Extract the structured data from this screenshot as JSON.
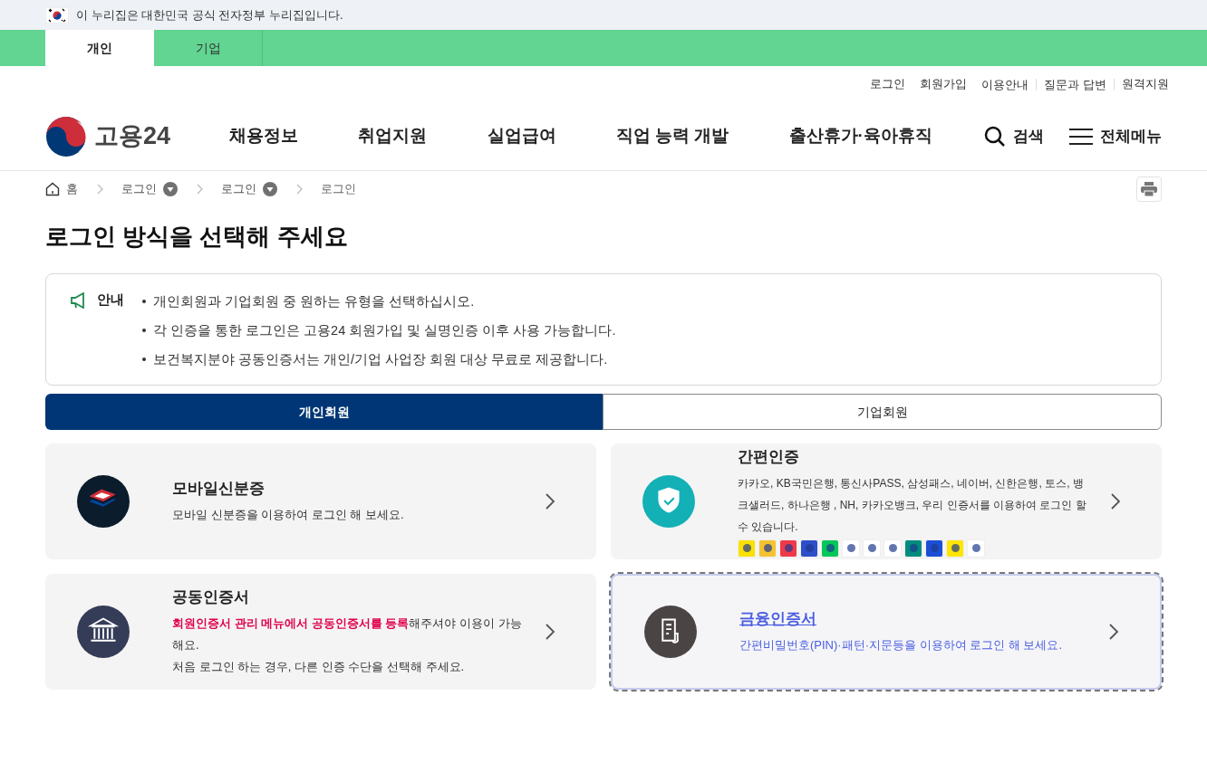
{
  "gov_banner": {
    "text": "이 누리집은 대한민국 공식 전자정부 누리집입니다."
  },
  "site_tabs": [
    {
      "label": "개인",
      "selected": true
    },
    {
      "label": "기업",
      "selected": false
    }
  ],
  "utility_links": [
    {
      "label": "로그인",
      "divider": false
    },
    {
      "label": "회원가입",
      "divider": false
    },
    {
      "label": "이용안내",
      "divider": true
    },
    {
      "label": "질문과 답변",
      "divider": true
    },
    {
      "label": "원격지원",
      "divider": false
    }
  ],
  "header": {
    "logo_text": "고용24",
    "nav": [
      "채용정보",
      "취업지원",
      "실업급여",
      "직업 능력 개발",
      "출산휴가·육아휴직"
    ],
    "search_label": "검색",
    "menu_label": "전체메뉴"
  },
  "breadcrumb": [
    {
      "label": "홈",
      "kind": "home"
    },
    {
      "label": "로그인",
      "kind": "dropdown"
    },
    {
      "label": "로그인",
      "kind": "dropdown"
    },
    {
      "label": "로그인",
      "kind": "current"
    }
  ],
  "page_title": "로그인 방식을 선택해 주세요",
  "notice": {
    "label": "안내",
    "items": [
      "개인회원과 기업회원 중 원하는 유형을 선택하십시오.",
      "각 인증을 통한 로그인은 고용24 회원가입 및 실명인증 이후 사용 가능합니다.",
      "보건복지분야 공동인증서는 개인/기업 사업장 회원 대상 무료로 제공합니다."
    ]
  },
  "member_tabs": [
    {
      "label": "개인회원",
      "selected": true
    },
    {
      "label": "기업회원",
      "selected": false
    }
  ],
  "login_options": [
    {
      "kind": "mobile_id",
      "title": "모바일신분증",
      "focused": false,
      "lines": [
        "모바일 신분증을 이용하여 로그인 해 보세요."
      ]
    },
    {
      "kind": "simple",
      "title": "간편인증",
      "focused": false,
      "lines": [
        "카카오, KB국민은행, 통신사PASS, 삼성패스, 네이버, 신한은행, 토스, 뱅크샐러드, 하나은행 , NH, 카카오뱅크, 우리 인증서를 이용하여 로그인 할 수 있습니다."
      ],
      "providers": [
        {
          "color": "#fae100"
        },
        {
          "color": "#f5c230"
        },
        {
          "color": "#f0384b"
        },
        {
          "color": "#2d4fc9"
        },
        {
          "color": "#03c75a"
        },
        {
          "color": "#ffffff"
        },
        {
          "color": "#ffffff"
        },
        {
          "color": "#ffffff"
        },
        {
          "color": "#008c7e"
        },
        {
          "color": "#1a4fd6"
        },
        {
          "color": "#ffe600"
        },
        {
          "color": "#ffffff"
        }
      ]
    },
    {
      "kind": "joint",
      "title": "공동인증서",
      "focused": false,
      "lines": [
        "**회원인증서 관리 메뉴에서 공동인증서를 등록**해주셔야 이용이 가능해요.",
        "처음 로그인 하는 경우, 다른 인증 수단을 선택해 주세요."
      ]
    },
    {
      "kind": "financial",
      "title": "금융인증서",
      "focused": true,
      "lines": [
        "간편비밀번호(PIN)·패턴·지문등을 이용하여 로그인 해 보세요."
      ]
    }
  ]
}
